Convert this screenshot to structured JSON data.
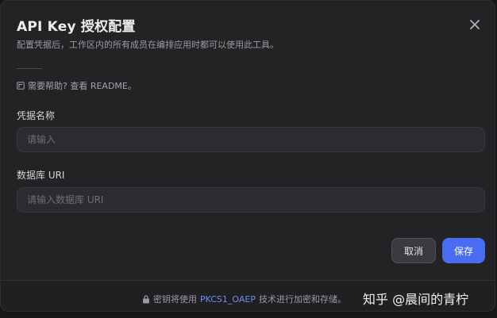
{
  "dialog": {
    "title": "API Key 授权配置",
    "subtitle": "配置凭据后，工作区内的所有成员在编排应用时都可以使用此工具。",
    "help_text": "需要帮助? 查看 README。",
    "close_icon": "close-icon"
  },
  "fields": [
    {
      "label": "凭据名称",
      "placeholder": "请输入",
      "value": ""
    },
    {
      "label": "数据库 URI",
      "placeholder": "请输入数据库 URI",
      "value": ""
    }
  ],
  "actions": {
    "cancel_label": "取消",
    "save_label": "保存"
  },
  "footer": {
    "icon": "lock-icon",
    "text_before": "密钥将使用",
    "link_text": "PKCS1_OAEP",
    "text_after": "技术进行加密和存储。",
    "watermark": "知乎 @晨间的青柠"
  },
  "colors": {
    "primary": "#4a6cf0",
    "link": "#6f8cf5",
    "background": "#232326"
  }
}
